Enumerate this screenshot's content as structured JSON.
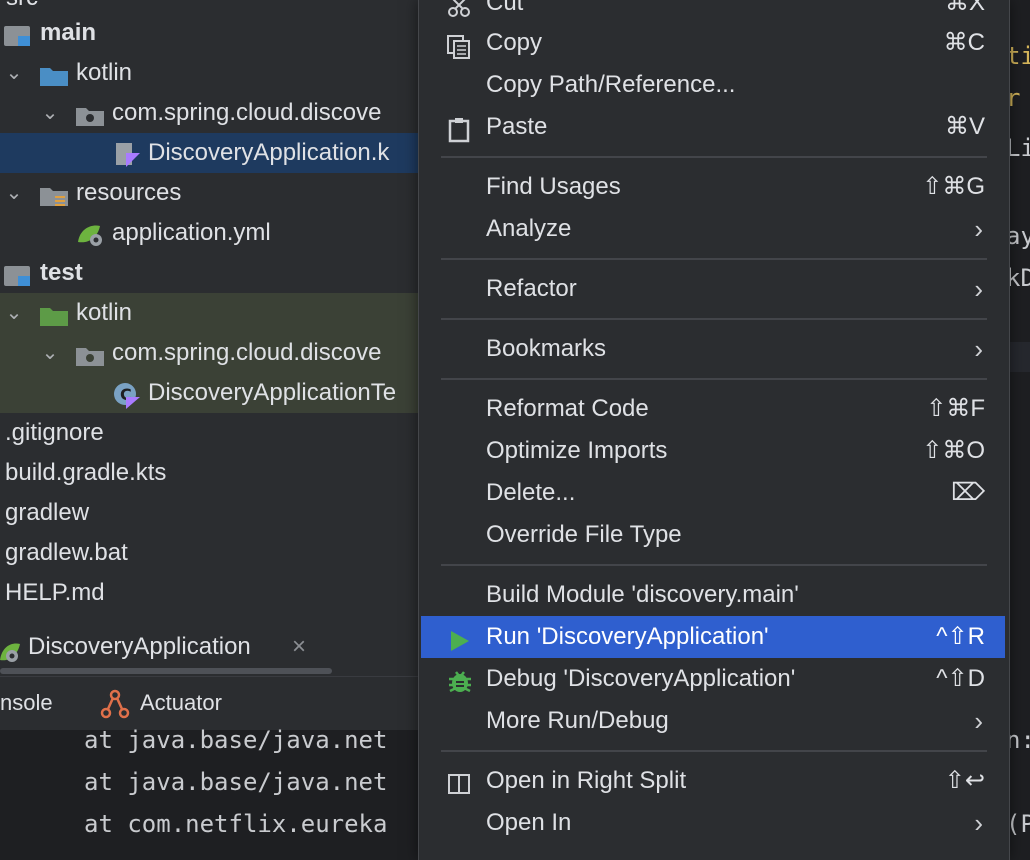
{
  "tree": {
    "top_partial": "src",
    "items": [
      {
        "label": "main",
        "bold": true
      },
      {
        "label": "kotlin"
      },
      {
        "label": "com.spring.cloud.discove"
      },
      {
        "label": "DiscoveryApplication.k"
      },
      {
        "label": "resources"
      },
      {
        "label": "application.yml"
      },
      {
        "label": "test",
        "bold": true
      },
      {
        "label": "kotlin"
      },
      {
        "label": "com.spring.cloud.discove"
      },
      {
        "label": "DiscoveryApplicationTe"
      },
      {
        "label": ".gitignore"
      },
      {
        "label": "build.gradle.kts"
      },
      {
        "label": "gradlew"
      },
      {
        "label": "gradlew.bat"
      },
      {
        "label": "HELP.md"
      }
    ]
  },
  "run_window": {
    "tab_label": "DiscoveryApplication",
    "tab_close": "×",
    "subtabs": {
      "console": "nsole",
      "actuator": "Actuator"
    },
    "console_lines": [
      "at java.base/java.net",
      "at java.base/java.net",
      "at com.netflix.eureka"
    ]
  },
  "editor_fragments": [
    "ti",
    "r",
    "Li",
    "ay",
    "kD",
    "n:",
    "(P"
  ],
  "menu": {
    "cut": {
      "label": "Cut",
      "shortcut": "⌘X"
    },
    "copy": {
      "label": "Copy",
      "shortcut": "⌘C"
    },
    "copy_path": {
      "label": "Copy Path/Reference..."
    },
    "paste": {
      "label": "Paste",
      "shortcut": "⌘V"
    },
    "find_usages": {
      "label": "Find Usages",
      "shortcut": "⇧⌘G"
    },
    "analyze": {
      "label": "Analyze"
    },
    "refactor": {
      "label": "Refactor"
    },
    "bookmarks": {
      "label": "Bookmarks"
    },
    "reformat": {
      "label": "Reformat Code",
      "shortcut": "⇧⌘F"
    },
    "optimize": {
      "label": "Optimize Imports",
      "shortcut": "⇧⌘O"
    },
    "delete": {
      "label": "Delete...",
      "shortcut": "⌦"
    },
    "override": {
      "label": "Override File Type"
    },
    "build_module": {
      "label": "Build Module 'discovery.main'"
    },
    "run": {
      "label": "Run 'DiscoveryApplication'",
      "shortcut": "^⇧R"
    },
    "debug": {
      "label": "Debug 'DiscoveryApplication'",
      "shortcut": "^⇧D"
    },
    "more_run": {
      "label": "More Run/Debug"
    },
    "open_right": {
      "label": "Open in Right Split",
      "shortcut": "⇧↩"
    },
    "open_in": {
      "label": "Open In"
    },
    "submenu_arrow": "›"
  },
  "colors": {
    "selection": "#1e3a5f",
    "menu_highlight": "#2f5fcf",
    "run_green": "#4caf50",
    "kotlin_purple": "#a97bff"
  }
}
